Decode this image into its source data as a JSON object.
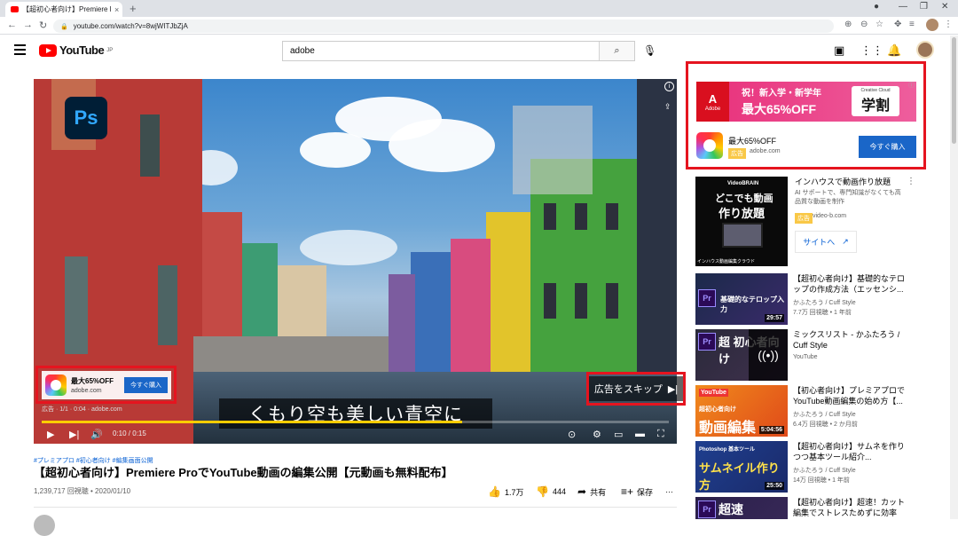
{
  "browser": {
    "tab_title": "【超初心者向け】Premiere ProでYo...",
    "tab_close": "×",
    "new_tab": "+",
    "url": "youtube.com/watch?v=8wjWITJbZjA",
    "minimize": "—",
    "restore": "❐",
    "close": "✕"
  },
  "header": {
    "logo_text": "YouTube",
    "logo_sup": "JP",
    "search_value": "adobe"
  },
  "player": {
    "ps_label": "Ps",
    "ad_card": {
      "title": "最大65%OFF",
      "domain": "adobe.com",
      "button": "今すぐ購入"
    },
    "skip_label": "広告をスキップ",
    "caption_meta": "広告 · 1/1 · 0:04 · adobe.com",
    "subtitle": "くもり空も美しい青空に",
    "time": "0:10 / 0:15",
    "progress": 0.67,
    "progress_color": "#ffcc00"
  },
  "video": {
    "hashtags": "#プレミアプロ #初心者向け #編集画面公開",
    "title": "【超初心者向け】Premiere ProでYouTube動画の編集公開【元動画も無料配布】",
    "meta": "1,239,717 回視聴 • 2020/01/10",
    "likes": "1.7万",
    "dislikes": "444",
    "share": "共有",
    "save": "保存",
    "more": "…"
  },
  "right_ad": {
    "adobe_word": "Adobe",
    "line1": "祝！新入学・新学年",
    "line2": "最大65%OFF",
    "badge_small": "Creative Cloud",
    "badge_big": "学割",
    "headline": "最大65%OFF",
    "ad_badge": "広告",
    "domain": "adobe.com",
    "buy": "今すぐ購入"
  },
  "sidebar": [
    {
      "title": "インハウスで動画作り放題",
      "desc": "AI サポートで、専門知識がなくても高品質な動画を制作",
      "ad_badge": "広告",
      "domain": "video-b.com",
      "site_button": "サイトへ",
      "thumb_brand": "VideoBRAIN",
      "thumb_line1": "どこでも動画",
      "thumb_line2": "作り放題",
      "thumb_footer": "インハウス動画編集クラウド"
    },
    {
      "title": "【超初心者向け】基礎的なテロップの作成方法（エッセンシ...",
      "channel": "かふたろう / Cuff Style",
      "meta": "7.7万 回視聴 • 1 年前",
      "duration": "29:57",
      "thumb_text": "基礎的なテロップ入力"
    },
    {
      "title": "ミックスリスト - かふたろう / Cuff Style",
      "channel": "YouTube",
      "meta": "",
      "duration": "",
      "thumb_text": "超 初心者向け"
    },
    {
      "title": "【初心者向け】プレミアプロでYouTube動画編集の始め方【...",
      "channel": "かふたろう / Cuff Style",
      "meta": "6.4万 回視聴 • 2 か月前",
      "duration": "5:04:56",
      "thumb_text": "動画編集"
    },
    {
      "title": "【超初心者向け】サムネを作りつつ基本ツール紹介...",
      "channel": "かふたろう / Cuff Style",
      "meta": "14万 回視聴 • 1 年前",
      "duration": "25:50",
      "thumb_text": "サムネイル作り方"
    },
    {
      "title": "【超初心者向け】超速！カット編集でストレスためずに効率良...",
      "channel": "",
      "meta": "",
      "duration": "",
      "thumb_text": "超速"
    }
  ]
}
